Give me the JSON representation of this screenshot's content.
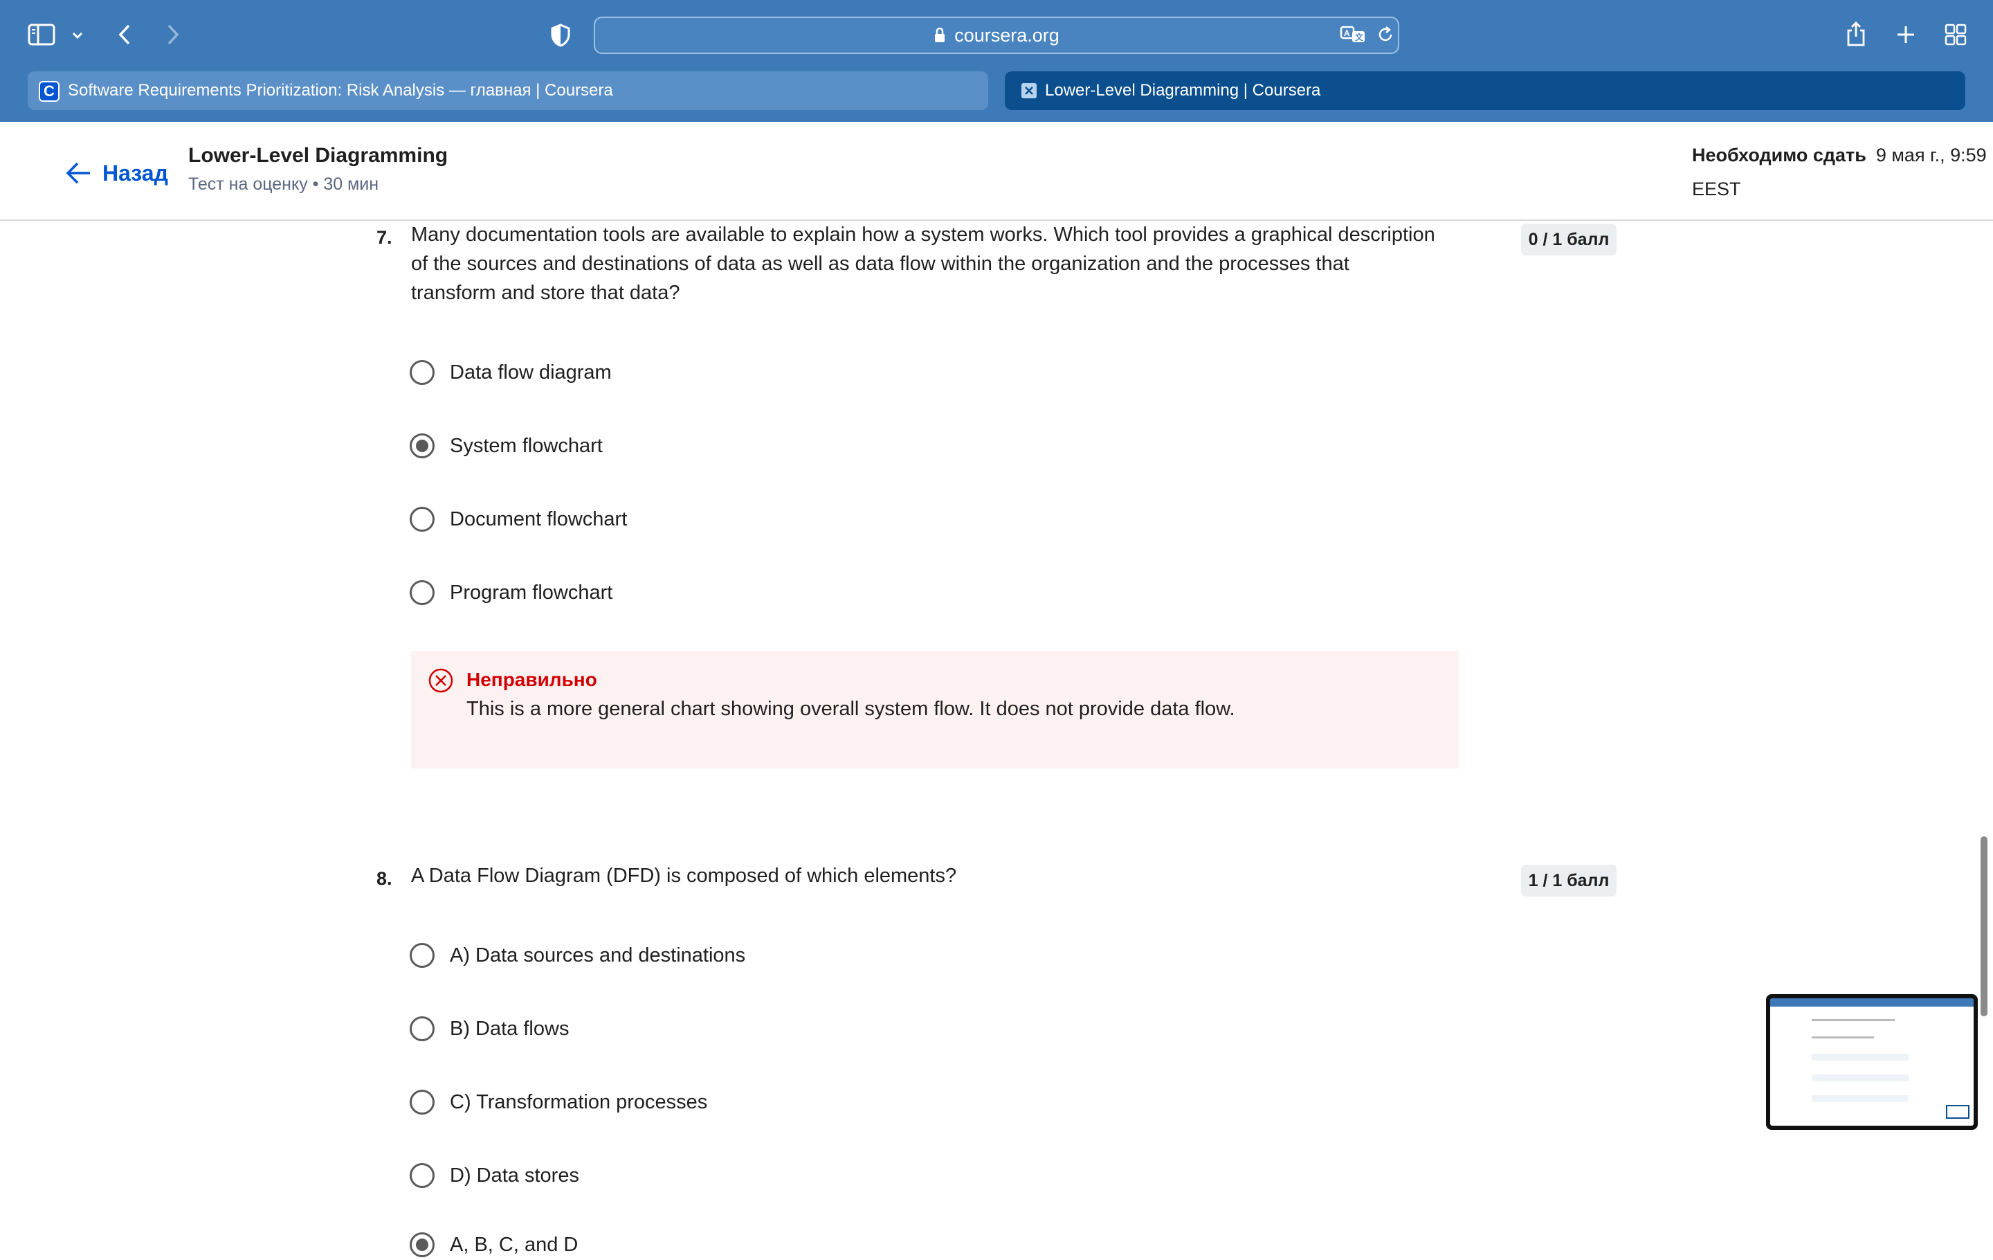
{
  "browser": {
    "url": "coursera.org",
    "tabs": [
      {
        "label": "Software Requirements Prioritization: Risk Analysis — главная | Coursera",
        "active": false
      },
      {
        "label": "Lower-Level Diagramming | Coursera",
        "active": true
      }
    ],
    "icons": [
      "sidebar-icon",
      "chevron-down-icon",
      "back-arrow-icon",
      "forward-arrow-icon",
      "shield-icon",
      "lock-icon",
      "translate-icon",
      "reload-icon",
      "share-icon",
      "plus-icon",
      "tab-overview-icon"
    ],
    "colors": {
      "toolbar": "#3f7ab8",
      "active_tab": "#0b4f8f"
    }
  },
  "header": {
    "back_label": "Назад",
    "title": "Lower-Level Diagramming",
    "subtitle": "Тест на оценку • 30 мин",
    "due_label": "Необходимо сдать",
    "due_date": "9 мая г., 9:59",
    "timezone": "EEST"
  },
  "questions": [
    {
      "number": "7.",
      "text_lines": [
        "Many documentation tools are available to explain how a system works. Which tool provides a graphical description",
        "of the sources and destinations of data as well as data flow within the organization and the processes that",
        "transform and store that data?"
      ],
      "score": "0 / 1 балл",
      "options": [
        {
          "label": "Data flow diagram",
          "selected": false
        },
        {
          "label": "System flowchart",
          "selected": true
        },
        {
          "label": "Document flowchart",
          "selected": false
        },
        {
          "label": "Program flowchart",
          "selected": false
        }
      ],
      "feedback": {
        "status": "Неправильно",
        "text": "This is a more general chart showing overall system flow. It does not provide data flow.",
        "color": "#d30001"
      }
    },
    {
      "number": "8.",
      "text": "A Data Flow Diagram (DFD) is composed of which elements?",
      "score": "1 / 1 балл",
      "options": [
        {
          "label": "A) Data sources and destinations",
          "selected": false
        },
        {
          "label": "B) Data flows",
          "selected": false
        },
        {
          "label": "C) Transformation processes",
          "selected": false
        },
        {
          "label": "D) Data stores",
          "selected": false
        },
        {
          "label": "A, B, C, and D",
          "selected": true
        }
      ]
    }
  ]
}
